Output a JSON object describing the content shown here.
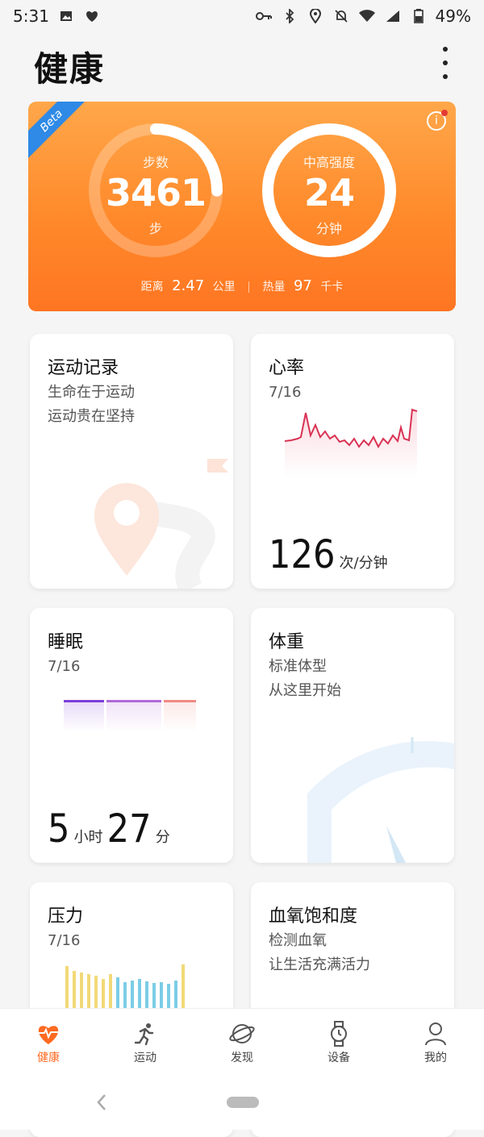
{
  "status": {
    "time": "5:31",
    "battery": "49%"
  },
  "header": {
    "title": "健康"
  },
  "hero": {
    "badge": "Beta",
    "steps": {
      "label": "步数",
      "value": "3461",
      "unit": "步"
    },
    "intensity": {
      "label": "中高强度",
      "value": "24",
      "unit": "分钟"
    },
    "footer": {
      "distance_label": "距离",
      "distance_value": "2.47",
      "distance_unit": "公里",
      "calorie_label": "热量",
      "calorie_value": "97",
      "calorie_unit": "千卡"
    },
    "colors": {
      "accent": "#ff8a2b"
    }
  },
  "cards": {
    "exercise": {
      "title": "运动记录",
      "line1": "生命在于运动",
      "line2": "运动贵在坚持"
    },
    "heart": {
      "title": "心率",
      "date": "7/16",
      "value": "126",
      "unit": "次/分钟"
    },
    "sleep": {
      "title": "睡眠",
      "date": "7/16",
      "hours": "5",
      "hours_unit": "小时",
      "minutes": "27",
      "minutes_unit": "分"
    },
    "weight": {
      "title": "体重",
      "line1": "标准体型",
      "line2": "从这里开始"
    },
    "stress": {
      "title": "压力",
      "date": "7/16"
    },
    "spo2": {
      "title": "血氧饱和度",
      "line1": "检测血氧",
      "line2": "让生活充满活力"
    }
  },
  "nav": [
    {
      "label": "健康",
      "icon": "heart-icon"
    },
    {
      "label": "运动",
      "icon": "runner-icon"
    },
    {
      "label": "发现",
      "icon": "planet-icon"
    },
    {
      "label": "设备",
      "icon": "watch-icon"
    },
    {
      "label": "我的",
      "icon": "person-icon"
    }
  ]
}
